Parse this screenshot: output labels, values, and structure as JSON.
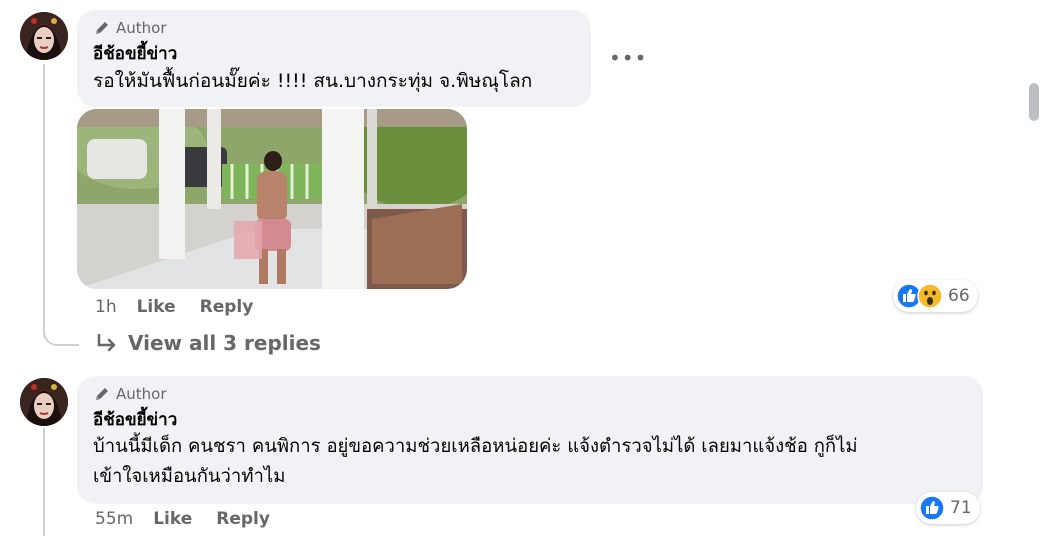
{
  "comments": [
    {
      "author_badge": "Author",
      "name": "อีช้อขยี้ข่าว",
      "text": "รอให้มันฟื้นก่อนมั๊ยค่ะ !!!! สน.บางกระทุ่ม จ.พิษณุโลก",
      "time": "1h",
      "like_label": "Like",
      "reply_label": "Reply",
      "reaction_count": "66",
      "reactions": [
        "like-icon",
        "wow-icon"
      ],
      "view_replies": "View all 3 replies"
    },
    {
      "author_badge": "Author",
      "name": "อีช้อขยี้ข่าว",
      "text_line1": "บ้านนี้มีเด็ก คนชรา คนพิการ อยู่ขอความช่วยเหลือหน่อยค่ะ แจ้งตำรวจไม่ได้ เลยมาแจ้งช้อ กูก็ไม่",
      "text_line2": "เข้าใจเหมือนกันว่าทำไม",
      "time": "55m",
      "like_label": "Like",
      "reply_label": "Reply",
      "reaction_count": "71",
      "reactions": [
        "like-icon"
      ]
    }
  ],
  "colors": {
    "bubble": "#f0f2f5",
    "secondary_text": "#65676b",
    "like_blue": "#1877f2",
    "wow_yellow": "#f7b928"
  }
}
